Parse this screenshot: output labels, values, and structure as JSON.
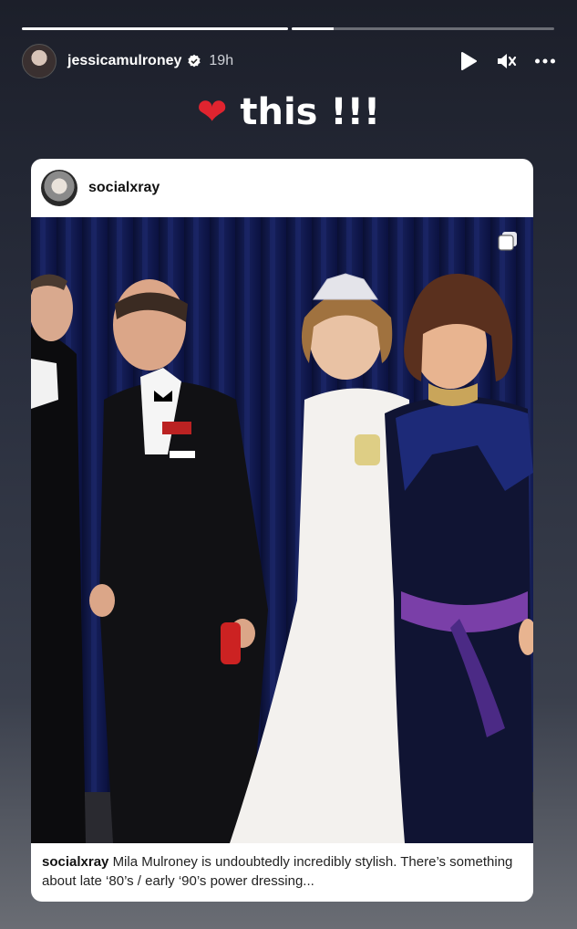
{
  "story": {
    "progress": [
      1.0,
      0.16
    ],
    "username": "jessicamulroney",
    "time": "19h",
    "text": "this !!!",
    "heart_emoji": "❤"
  },
  "post": {
    "username": "socialxray",
    "caption_user": "socialxray",
    "caption_text": "Mila Mulroney is undoubtedly incredibly stylish. There’s something about late ‘80’s / early ‘90’s power dressing..."
  },
  "icons": {
    "play": "play-icon",
    "mute": "mute-icon",
    "more": "more-icon",
    "verified": "verified-badge-icon",
    "multi": "multi-image-icon"
  },
  "colors": {
    "heart": "#e0242f",
    "verified": "#ffffff"
  }
}
